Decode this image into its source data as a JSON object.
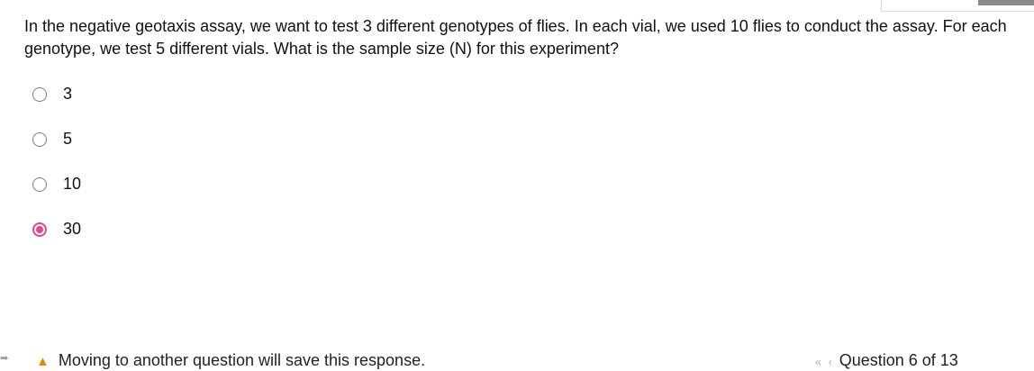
{
  "question": {
    "text": "In the negative geotaxis assay, we want to test 3 different genotypes of flies. In each vial, we used 10 flies to conduct the assay. For each genotype, we test 5 different vials. What is the sample size (N) for this experiment?"
  },
  "choices": [
    {
      "label": "3",
      "selected": false
    },
    {
      "label": "5",
      "selected": false
    },
    {
      "label": "10",
      "selected": false
    },
    {
      "label": "30",
      "selected": true
    }
  ],
  "accent_color": "#e6478c",
  "footer": {
    "warning_icon": "warning-icon",
    "warning_text": "Moving to another question will save this response.",
    "first_icon": "first-page-icon",
    "prev_icon": "previous-icon",
    "position_text": "Question 6 of 13"
  }
}
